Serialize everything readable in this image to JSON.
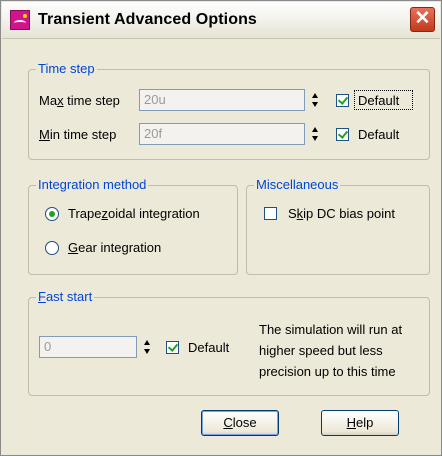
{
  "window": {
    "title": "Transient Advanced Options"
  },
  "time_step": {
    "legend": "Time step",
    "max": {
      "label_pre": "Ma",
      "label_key": "x",
      "label_post": " time step",
      "value": "20u",
      "default_label": "Default",
      "default_checked": true
    },
    "min": {
      "label_pre": "",
      "label_key": "M",
      "label_post": "in time step",
      "value": "20f",
      "default_label": "Default",
      "default_checked": true
    }
  },
  "integration": {
    "legend": "Integration method",
    "trapezoidal": {
      "label_pre": "Trape",
      "label_key": "z",
      "label_post": "oidal integration",
      "selected": true
    },
    "gear": {
      "label_pre": "",
      "label_key": "G",
      "label_post": "ear integration",
      "selected": false
    }
  },
  "misc": {
    "legend": "Miscellaneous",
    "skip_dc": {
      "label_pre": "S",
      "label_key": "k",
      "label_post": "ip DC bias point",
      "checked": false
    }
  },
  "fast_start": {
    "legend_key": "F",
    "legend_post": "ast start",
    "value": "0",
    "default_label": "Default",
    "default_checked": true,
    "description": [
      "The simulation will run at",
      "higher speed but less",
      "precision up to this time"
    ]
  },
  "buttons": {
    "close": {
      "key": "C",
      "rest": "lose"
    },
    "help": {
      "key": "H",
      "rest": "elp"
    }
  }
}
